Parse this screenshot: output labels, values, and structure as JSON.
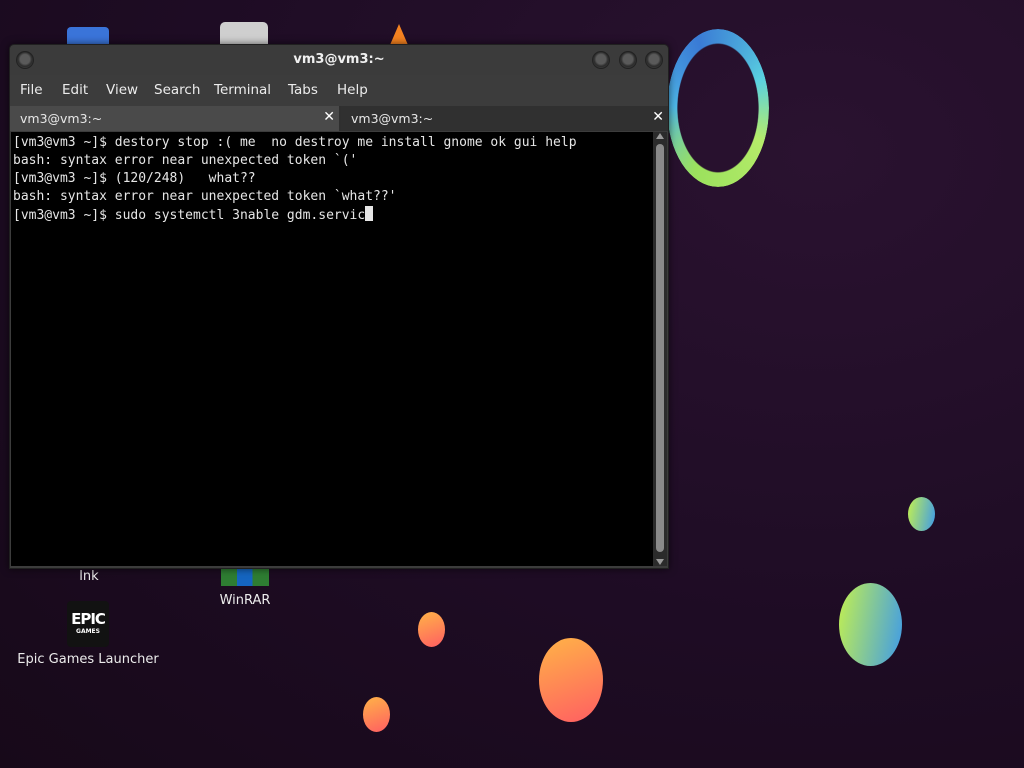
{
  "window": {
    "title": "vm3@vm3:~",
    "menu": [
      "File",
      "Edit",
      "View",
      "Search",
      "Terminal",
      "Tabs",
      "Help"
    ],
    "tabs": [
      {
        "label": "vm3@vm3:~",
        "close": "✕"
      },
      {
        "label": "vm3@vm3:~",
        "close": "✕"
      }
    ]
  },
  "terminal": {
    "lines": [
      "[vm3@vm3 ~]$ destory stop :( me  no destroy me install gnome ok gui help",
      "bash: syntax error near unexpected token `('",
      "[vm3@vm3 ~]$ (120/248)   what??",
      "bash: syntax error near unexpected token `what??'",
      "[vm3@vm3 ~]$ sudo systemctl 3nable gdm.servic"
    ]
  },
  "desktop": {
    "icons": [
      {
        "label": "lnk"
      },
      {
        "label": "WinRAR"
      },
      {
        "label": "Epic Games Launcher",
        "logo_line1": "EPIC",
        "logo_line2": "GAMES"
      }
    ]
  },
  "colors": {
    "terminal_bg": "#000000",
    "terminal_fg": "#e6e6e6",
    "window_chrome": "#3c3c3c"
  }
}
